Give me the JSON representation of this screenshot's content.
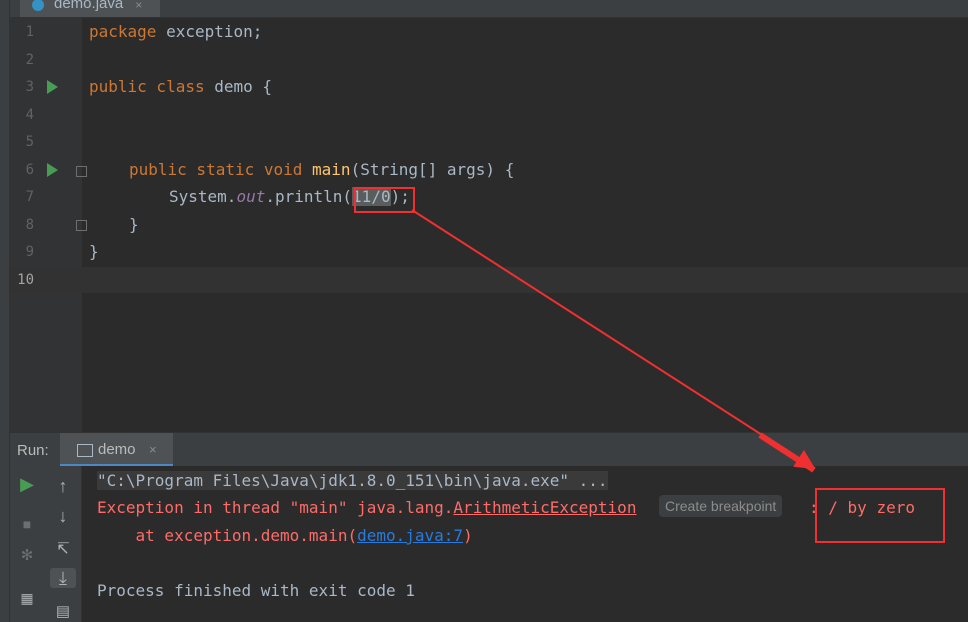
{
  "editor": {
    "file_tab": {
      "name": "demo.java",
      "close": "×"
    },
    "lines": [
      {
        "num": "1",
        "code": "package exception;"
      },
      {
        "num": "2",
        "code": ""
      },
      {
        "num": "3",
        "code": "public class demo {"
      },
      {
        "num": "4",
        "code": ""
      },
      {
        "num": "5",
        "code": ""
      },
      {
        "num": "6",
        "code": "public static void main(String[] args) {"
      },
      {
        "num": "7",
        "code": "System.out.println(11/0);"
      },
      {
        "num": "8",
        "code": "}"
      },
      {
        "num": "9",
        "code": "}"
      },
      {
        "num": "10",
        "code": ""
      }
    ]
  },
  "tokens": {
    "l1_kw": "package",
    "l1_rest": " exception;",
    "l3_kw": "public class",
    "l3_rest": " demo {",
    "l6_kw": "public static void",
    "l6_fn": "main",
    "l6_rest": "(String[] args) {",
    "l7_a": "System.",
    "l7_field": "out",
    "l7_b": ".println(",
    "l7_sel": "11/0",
    "l7_c": ");",
    "l8": "}",
    "l9": "}"
  },
  "run_panel": {
    "label": "Run:",
    "tab_label": "demo",
    "tab_close": "×",
    "console": {
      "cmd": "\"C:\\Program Files\\Java\\jdk1.8.0_151\\bin\\java.exe\" ...",
      "exc_prefix": "Exception in thread \"main\" java.lang.",
      "exc_class": "ArithmeticException",
      "exc_sep": ":",
      "exc_msg": " / by zero",
      "at_prefix": "    at exception.demo.main(",
      "at_link": "demo.java:7",
      "at_suffix": ")",
      "finish": "Process finished with exit code 1"
    },
    "breakpoint_hint": "Create breakpoint"
  },
  "colors": {
    "annotation": "#f03030",
    "error_text": "#ff6b68",
    "run_green": "#499c54"
  }
}
